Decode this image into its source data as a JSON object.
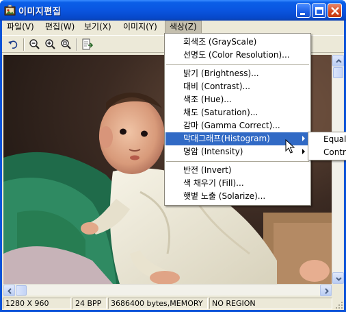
{
  "window": {
    "title": "이미지편집"
  },
  "menubar": {
    "items": [
      {
        "label": "파일(V)"
      },
      {
        "label": "편집(W)"
      },
      {
        "label": "보기(X)"
      },
      {
        "label": "이미지(Y)"
      },
      {
        "label": "색상(Z)"
      }
    ],
    "active_index": 4
  },
  "toolbar": {
    "buttons": [
      "undo-icon",
      "zoom-out-icon",
      "zoom-in-icon",
      "zoom-fit-icon",
      "export-icon"
    ]
  },
  "color_menu": {
    "items": [
      {
        "label": "회색조 (GrayScale)"
      },
      {
        "label": "선명도 (Color Resolution)..."
      },
      {
        "label": "밝기 (Brightness)..."
      },
      {
        "label": "대비 (Contrast)..."
      },
      {
        "label": "색조 (Hue)..."
      },
      {
        "label": "채도 (Saturation)..."
      },
      {
        "label": "감마 (Gamma Correct)..."
      },
      {
        "label": "막대그래프(Histogram)",
        "submenu": true,
        "highlighted": true
      },
      {
        "label": "명암 (Intensity)",
        "submenu": true
      },
      {
        "label": "반전 (Invert)"
      },
      {
        "label": "색 채우기 (Fill)..."
      },
      {
        "label": "햇볕 노출 (Solarize)..."
      }
    ]
  },
  "histogram_submenu": {
    "items": [
      {
        "label": "Equal"
      },
      {
        "label": "Contra"
      }
    ]
  },
  "statusbar": {
    "dimensions": "1280 X 960",
    "bpp": "24 BPP",
    "memory": "3686400 bytes,MEMORY",
    "region": "NO REGION"
  },
  "colors": {
    "titlebar": "#0a55e0",
    "menu_highlight": "#316ac5",
    "face": "#ece9d8"
  }
}
